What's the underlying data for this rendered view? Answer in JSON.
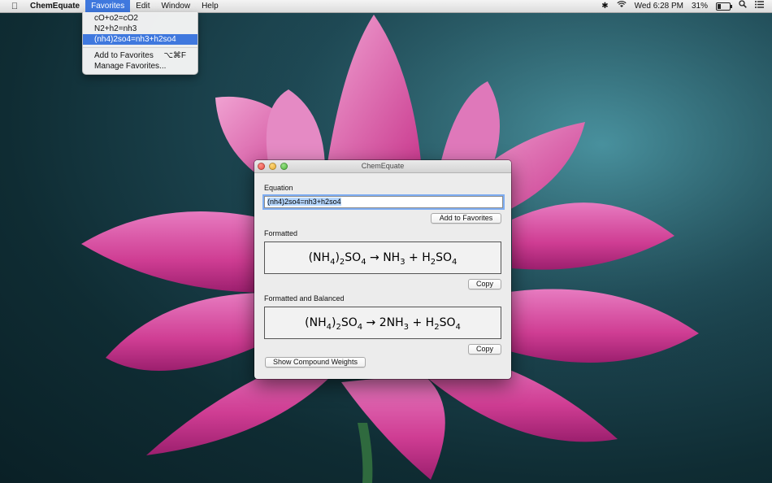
{
  "menubar": {
    "apple": "",
    "app_name": "ChemEquate",
    "menus": [
      "Favorites",
      "Edit",
      "Window",
      "Help"
    ],
    "open_menu": "Favorites",
    "status": {
      "bluetooth": "✱",
      "clock": "Wed 6:28 PM",
      "battery_percent": "31%",
      "battery_level": 0.31
    }
  },
  "favorites_menu": {
    "items": [
      "cO+o2=cO2",
      "N2+h2=nh3",
      "(nh4)2so4=nh3+h2so4"
    ],
    "selected_index": 2,
    "add_label": "Add to Favorites",
    "add_shortcut": "⌥⌘F",
    "manage_label": "Manage Favorites..."
  },
  "window": {
    "title": "ChemEquate",
    "equation_label": "Equation",
    "equation_value": "(nh4)2so4=nh3+h2so4",
    "add_to_favorites_button": "Add to Favorites",
    "formatted_label": "Formatted",
    "formatted_tokens": [
      {
        "t": "(NH"
      },
      {
        "s": "4"
      },
      {
        "t": ")"
      },
      {
        "s": "2"
      },
      {
        "t": "SO"
      },
      {
        "s": "4"
      },
      {
        "t": " → NH"
      },
      {
        "s": "3"
      },
      {
        "t": " + H"
      },
      {
        "s": "2"
      },
      {
        "t": "SO"
      },
      {
        "s": "4"
      }
    ],
    "copy_button": "Copy",
    "balanced_label": "Formatted and Balanced",
    "balanced_tokens": [
      {
        "t": "(NH"
      },
      {
        "s": "4"
      },
      {
        "t": ")"
      },
      {
        "s": "2"
      },
      {
        "t": "SO"
      },
      {
        "s": "4"
      },
      {
        "t": " → 2NH"
      },
      {
        "s": "3"
      },
      {
        "t": " + H"
      },
      {
        "s": "2"
      },
      {
        "t": "SO"
      },
      {
        "s": "4"
      }
    ],
    "copy_button_2": "Copy",
    "weights_button": "Show Compound Weights"
  },
  "colors": {
    "menu_highlight": "#3f78de",
    "lotus": "#d9489e",
    "background": "#1c4650"
  }
}
